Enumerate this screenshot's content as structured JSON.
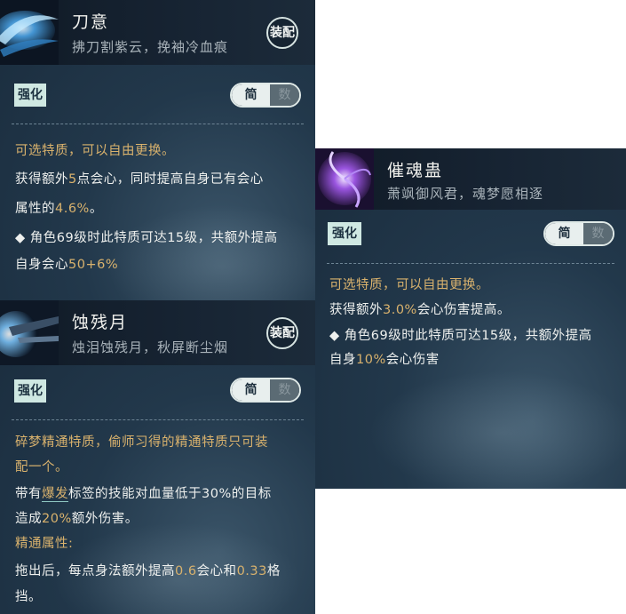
{
  "card1": {
    "title": "刀意",
    "subtitle": "拂刀割紫云，挽袖冷血痕",
    "equip_label": "装配",
    "strengthen_label": "强化",
    "toggle": {
      "simple": "简",
      "detail": "数"
    },
    "heading": "可选特质，可以自由更换。",
    "line1": {
      "a": "获得额外",
      "b": "5",
      "c": "点会心，同时提高自身已有会心"
    },
    "line2": {
      "a": "属性的",
      "b": "4.6%",
      "c": "。"
    },
    "line3": "◆ 角色69级时此特质可达15级，共额外提高",
    "line4": {
      "a": "自身会心",
      "b": "50+6%"
    }
  },
  "card2": {
    "title": "蚀残月",
    "subtitle": "烛泪蚀残月，秋屏断尘烟",
    "equip_label": "装配",
    "strengthen_label": "强化",
    "toggle": {
      "simple": "简",
      "detail": "数"
    },
    "heading1": "碎梦精通特质，偷师习得的精通特质只可装",
    "heading2": "配一个。",
    "line1": {
      "a": "带有",
      "b": "爆发",
      "c": "标签的技能对血量低于30%的目标"
    },
    "line2": {
      "a": "造成",
      "b": "20%",
      "c": "额外伤害。"
    },
    "section": "精通属性:",
    "line3": {
      "a": "拖出后，每点身法额外提高",
      "b": "0.6",
      "c": "会心和",
      "d": "0.33",
      "e": "格"
    },
    "line4": "挡。"
  },
  "card3": {
    "title": "催魂蛊",
    "subtitle": "萧飒御风君，魂梦愿相逐",
    "strengthen_label": "强化",
    "toggle": {
      "simple": "简",
      "detail": "数"
    },
    "heading": "可选特质，可以自由更换。",
    "line1": {
      "a": "获得额外",
      "b": "3.0%",
      "c": "会心伤害提高。"
    },
    "line2": "◆ 角色69级时此特质可达15级，共额外提高",
    "line3": {
      "a": "自身",
      "b": "10%",
      "c": "会心伤害"
    }
  },
  "colors": {
    "accent_gold": "#d9b26d",
    "panel_bg": "#22384b",
    "badge_bg": "#cfe8e2"
  },
  "icons": [
    "blade-swirl-icon",
    "crescent-blade-icon",
    "purple-vortex-icon"
  ]
}
